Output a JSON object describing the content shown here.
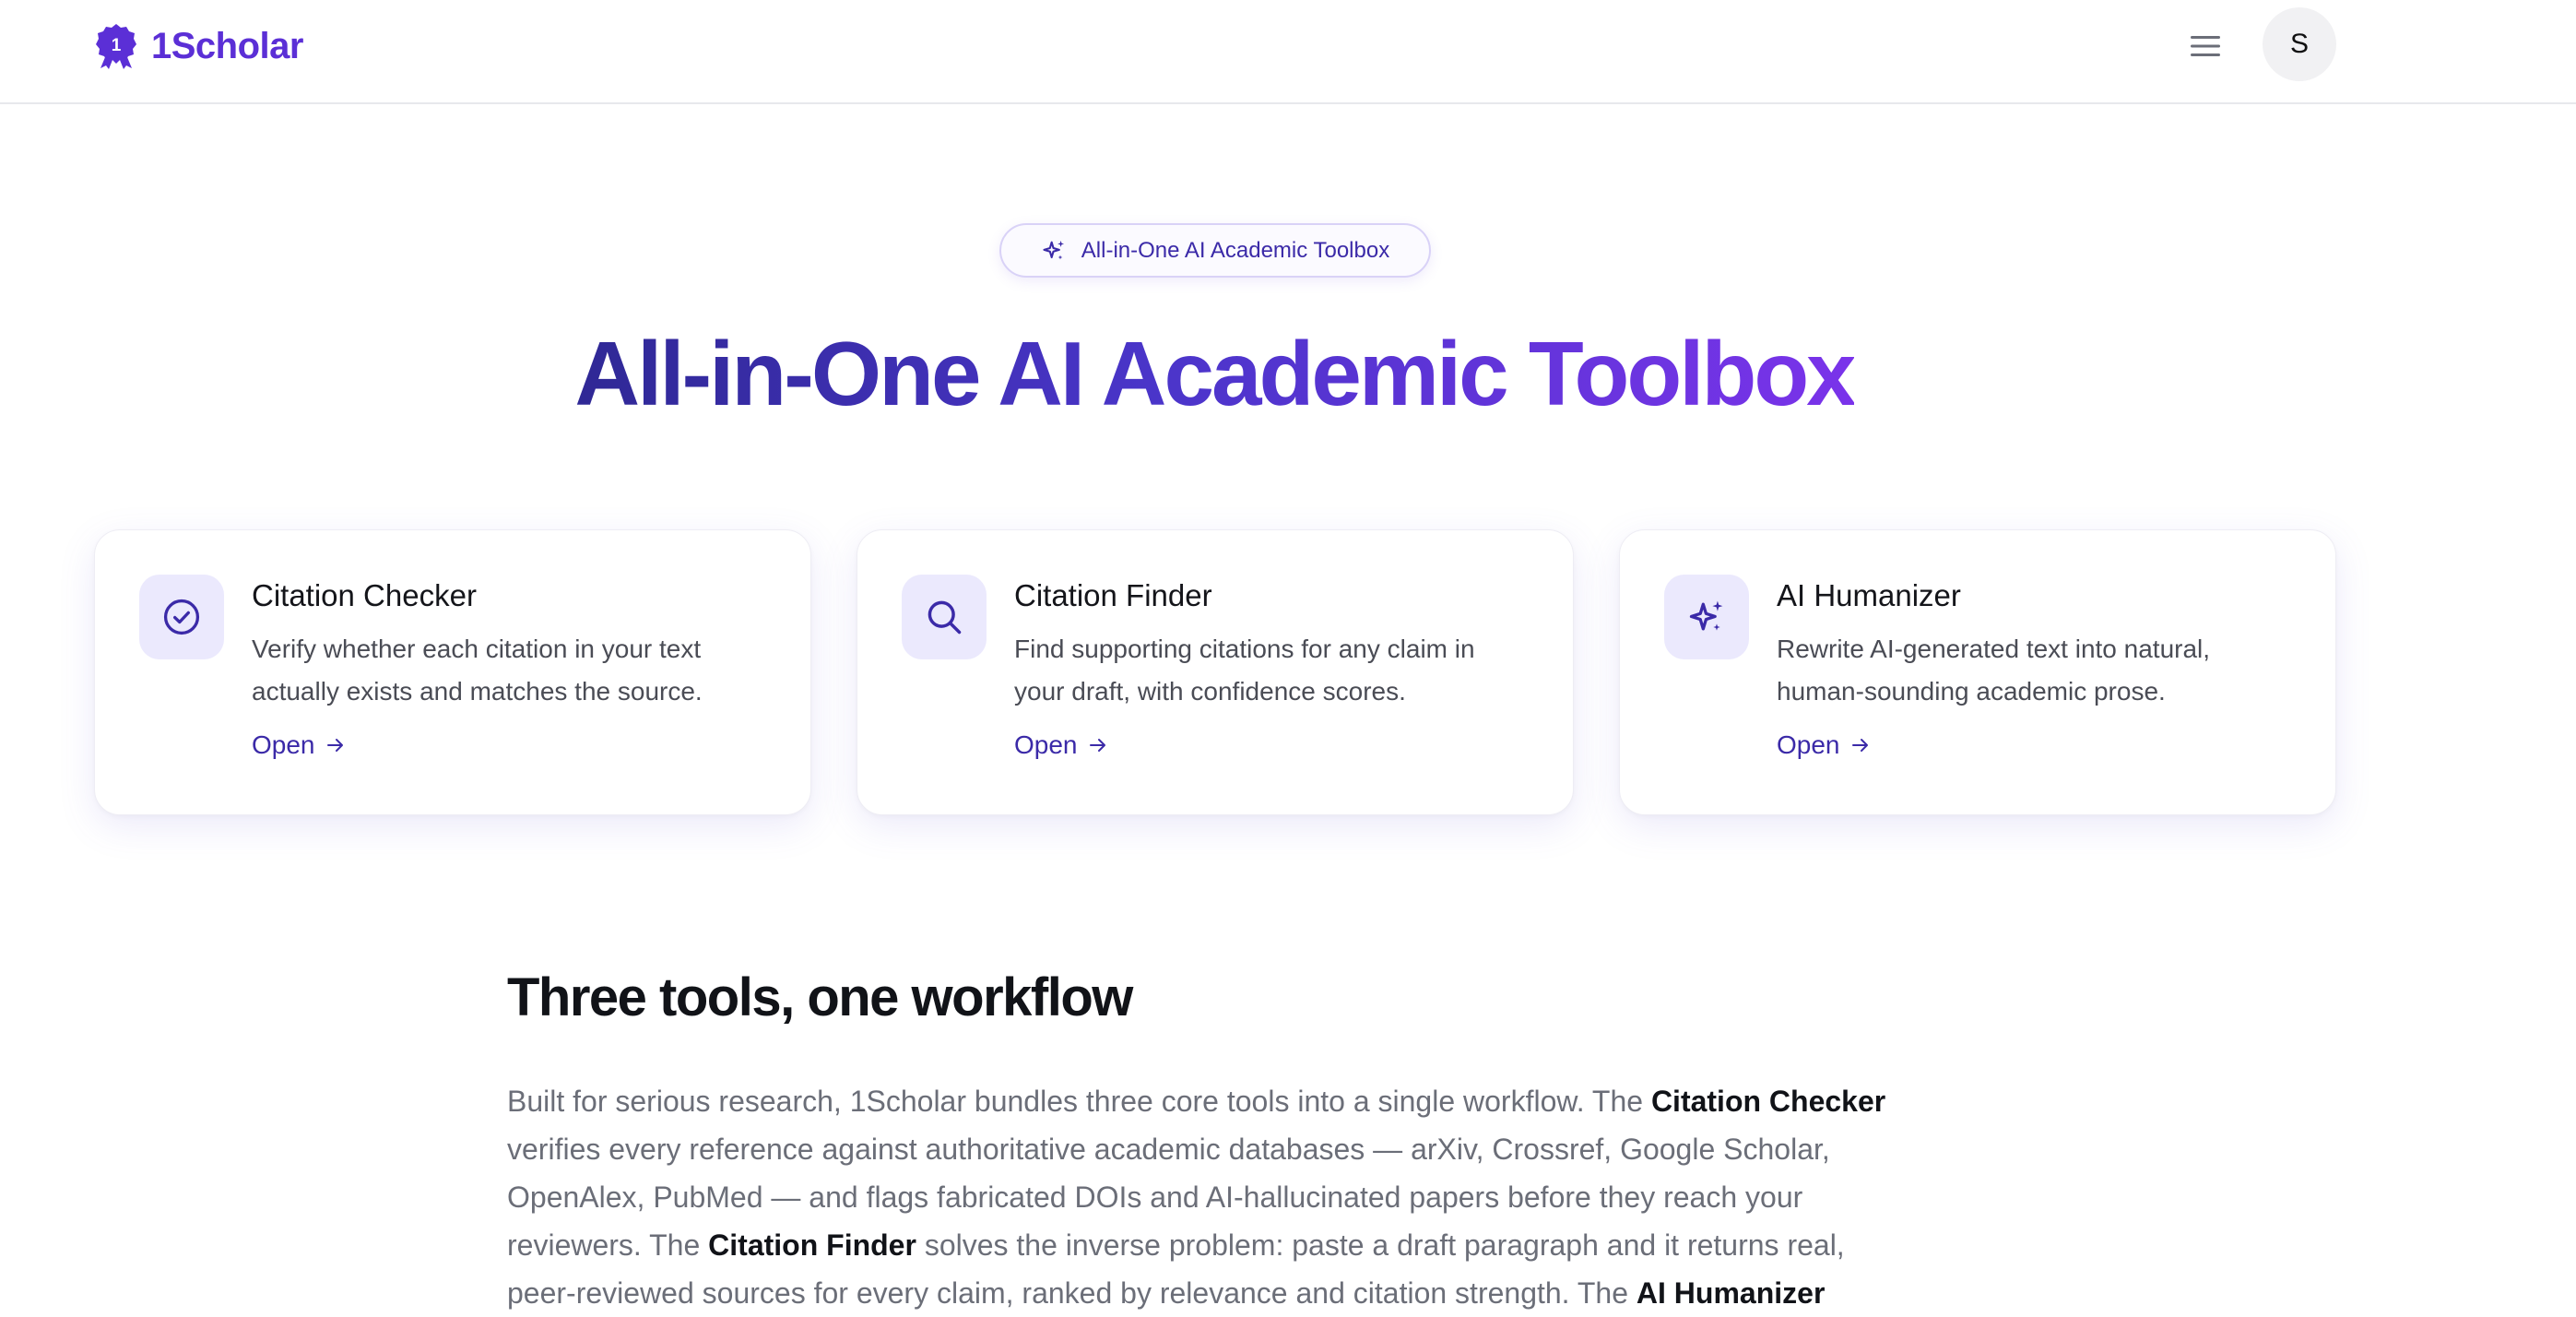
{
  "header": {
    "brand_name": "1Scholar",
    "logo_badge_text": "1",
    "avatar_initial": "S"
  },
  "hero": {
    "pill_label": "All-in-One AI Academic Toolbox",
    "title": "All-in-One AI Academic Toolbox"
  },
  "tools": [
    {
      "title": "Citation Checker",
      "description": "Verify whether each citation in your text actually exists and matches the source.",
      "link_label": "Open",
      "icon": "check-circle-icon"
    },
    {
      "title": "Citation Finder",
      "description": "Find supporting citations for any claim in your draft, with confidence scores.",
      "link_label": "Open",
      "icon": "search-icon"
    },
    {
      "title": "AI Humanizer",
      "description": "Rewrite AI-generated text into natural, human-sounding academic prose.",
      "link_label": "Open",
      "icon": "sparkles-icon"
    }
  ],
  "section": {
    "title": "Three tools, one workflow",
    "body": {
      "t1": "Built for serious research, 1Scholar bundles three core tools into a single workflow. The ",
      "b1": "Citation Checker",
      "t2": " verifies every reference against authoritative academic databases — arXiv, Crossref, Google Scholar, OpenAlex, PubMed — and flags fabricated DOIs and AI-hallucinated papers before they reach your reviewers. The ",
      "b2": "Citation Finder",
      "t3": " solves the inverse problem: paste a draft paragraph and it returns real, peer-reviewed sources for every claim, ranked by relevance and citation strength. The ",
      "b3": "AI Humanizer"
    }
  },
  "colors": {
    "brand": "#5b2fd6",
    "accent_link": "#3b2aa8",
    "icon_tile_bg": "#ebe9fd",
    "title_gradient_start": "#2f2895",
    "title_gradient_end": "#7a33ea"
  }
}
